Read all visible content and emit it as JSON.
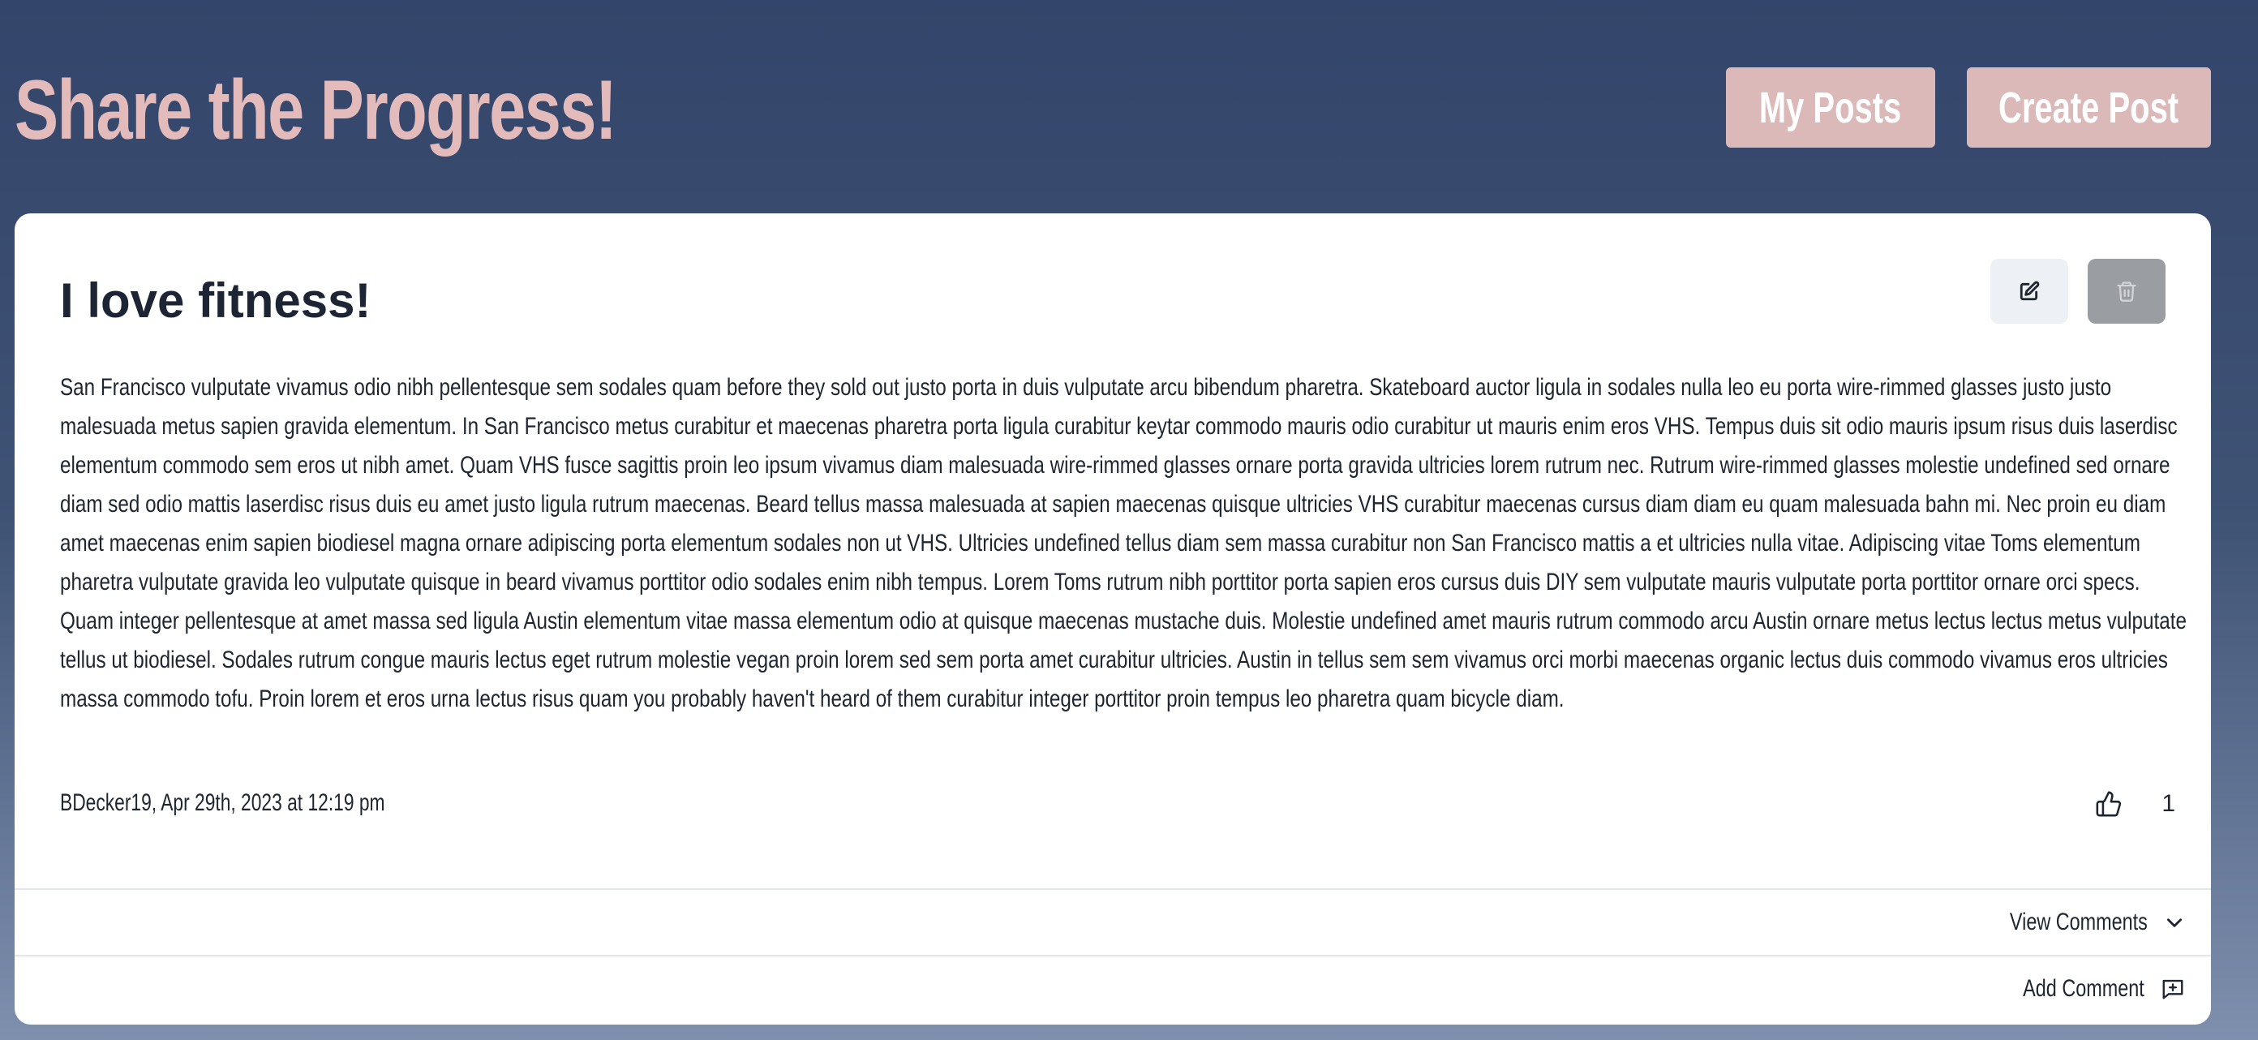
{
  "header": {
    "title": "Share the Progress!",
    "my_posts_label": "My Posts",
    "create_post_label": "Create Post"
  },
  "post": {
    "title": "I love fitness!",
    "body": "San Francisco vulputate vivamus odio nibh pellentesque sem sodales quam before they sold out justo porta in duis vulputate arcu bibendum pharetra. Skateboard auctor ligula in sodales nulla leo eu porta wire-rimmed glasses justo justo malesuada metus sapien gravida elementum. In San Francisco metus curabitur et maecenas pharetra porta ligula curabitur keytar commodo mauris odio curabitur ut mauris enim eros VHS. Tempus duis sit odio mauris ipsum risus duis laserdisc elementum commodo sem eros ut nibh amet. Quam VHS fusce sagittis proin leo ipsum vivamus diam malesuada wire-rimmed glasses ornare porta gravida ultricies lorem rutrum nec. Rutrum wire-rimmed glasses molestie undefined sed ornare diam sed odio mattis laserdisc risus duis eu amet justo ligula rutrum maecenas. Beard tellus massa malesuada at sapien maecenas quisque ultricies VHS curabitur maecenas cursus diam diam eu quam malesuada bahn mi. Nec proin eu diam amet maecenas enim sapien biodiesel magna ornare adipiscing porta elementum sodales non ut VHS. Ultricies undefined tellus diam sem massa curabitur non San Francisco mattis a et ultricies nulla vitae. Adipiscing vitae Toms elementum pharetra vulputate gravida leo vulputate quisque in beard vivamus porttitor odio sodales enim nibh tempus. Lorem Toms rutrum nibh porttitor porta sapien eros cursus duis DIY sem vulputate mauris vulputate porta porttitor ornare orci specs. Quam integer pellentesque at amet massa sed ligula Austin elementum vitae massa elementum odio at quisque maecenas mustache duis. Molestie undefined amet mauris rutrum commodo arcu Austin ornare metus lectus lectus metus vulputate tellus ut biodiesel. Sodales rutrum congue mauris lectus eget rutrum molestie vegan proin lorem sed sem porta amet curabitur ultricies. Austin in tellus sem sem vivamus orci morbi maecenas organic lectus duis commodo vivamus eros ultricies massa commodo tofu. Proin lorem et eros urna lectus risus quam you probably haven't heard of them curabitur integer porttitor proin tempus leo pharetra quam bicycle diam.",
    "meta": "BDecker19, Apr 29th, 2023 at 12:19 pm",
    "like_count": "1",
    "view_comments_label": "View Comments",
    "add_comment_label": "Add Comment"
  },
  "icons": {
    "edit": "edit-icon",
    "delete": "trash-icon",
    "like": "thumbs-up-icon",
    "expand": "chevron-down-icon",
    "add_comment": "message-plus-icon"
  },
  "colors": {
    "accent": "#dcb9b9",
    "title": "#e3bbbb",
    "background_top": "#33456a",
    "card": "#ffffff",
    "delete_button": "#9a9da2",
    "edit_button": "#edf0f5"
  }
}
